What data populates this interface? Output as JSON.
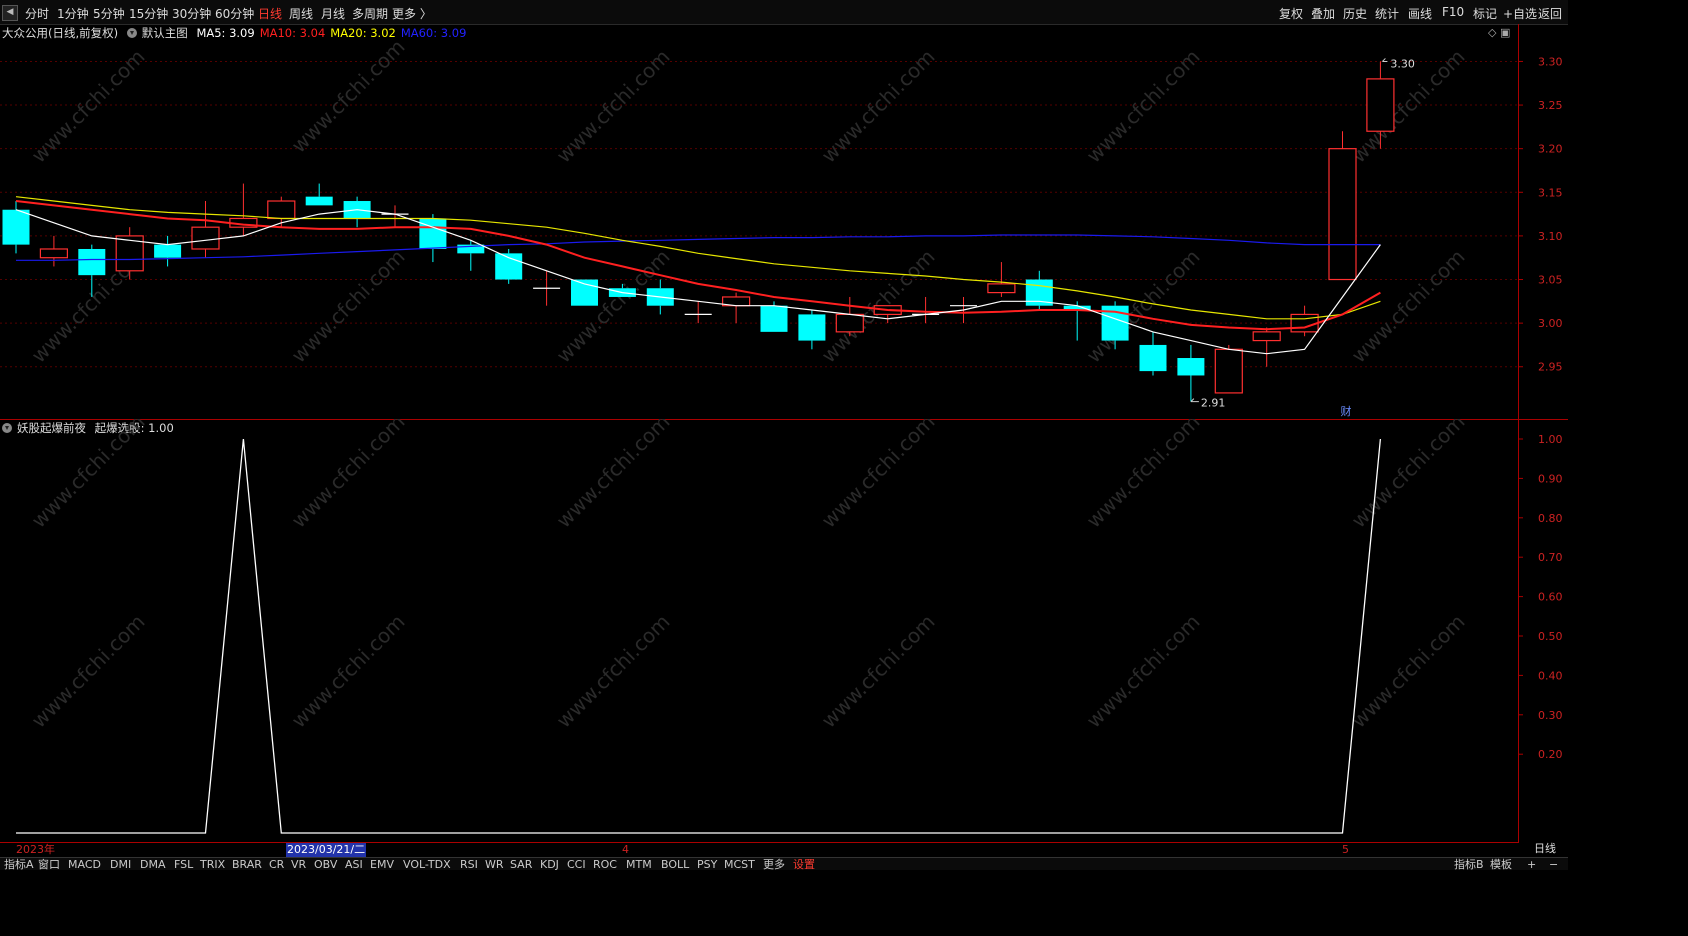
{
  "toolbar": {
    "collapse_icon": "chevron-left-icon",
    "periods": [
      "分时",
      "1分钟",
      "5分钟",
      "15分钟",
      "30分钟",
      "60分钟",
      "日线",
      "周线",
      "月线",
      "多周期",
      "更多 〉"
    ],
    "active_period": "日线",
    "tools": [
      "复权",
      "叠加",
      "历史",
      "统计",
      "画线",
      "F10",
      "标记",
      "+自选",
      "返回"
    ]
  },
  "main_panel": {
    "stock": "大众公用(日线,前复权)",
    "template": "默认主图",
    "ma": [
      {
        "label": "MA5:",
        "value": "3.09",
        "color": "#ffffff"
      },
      {
        "label": "MA10:",
        "value": "3.04",
        "color": "#ff2020"
      },
      {
        "label": "MA20:",
        "value": "3.02",
        "color": "#ffff00"
      },
      {
        "label": "MA60:",
        "value": "3.09",
        "color": "#2222ff"
      }
    ],
    "high_label": "3.30",
    "low_label": "2.91",
    "fin_badge": "财",
    "y_ticks": [
      "3.30",
      "3.25",
      "3.20",
      "3.15",
      "3.10",
      "3.05",
      "3.00",
      "2.95"
    ]
  },
  "indicator_panel": {
    "name": "妖股起爆前夜",
    "output": "起爆选股: 1.00",
    "y_ticks": [
      "1.00",
      "0.90",
      "0.80",
      "0.70",
      "0.60",
      "0.50",
      "0.40",
      "0.30",
      "0.20"
    ]
  },
  "date_axis": {
    "labels": [
      "2023年",
      "2023/03/21/二",
      "4",
      "5"
    ]
  },
  "bottom_tabs": [
    "指标A",
    "窗口",
    "MACD",
    "DMI",
    "DMA",
    "FSL",
    "TRIX",
    "BRAR",
    "CR",
    "VR",
    "OBV",
    "ASI",
    "EMV",
    "VOL-TDX",
    "RSI",
    "WR",
    "SAR",
    "KDJ",
    "CCI",
    "ROC",
    "MTM",
    "BOLL",
    "PSY",
    "MCST",
    "更多",
    "设置"
  ],
  "bottom_right": [
    "指标B",
    "模板",
    "+",
    "−"
  ],
  "right_button": "日线",
  "watermark": "www.cfchi.com",
  "chart_data": [
    {
      "type": "candlestick",
      "title": "大众公用(日线,前复权)",
      "ylim": [
        2.905,
        3.32
      ],
      "up_color": "#ff3030",
      "down_color": "#00ffff",
      "candles": [
        {
          "o": 3.13,
          "h": 3.14,
          "l": 3.08,
          "c": 3.09
        },
        {
          "o": 3.075,
          "h": 3.1,
          "l": 3.065,
          "c": 3.085
        },
        {
          "o": 3.085,
          "h": 3.09,
          "l": 3.03,
          "c": 3.055
        },
        {
          "o": 3.06,
          "h": 3.11,
          "l": 3.05,
          "c": 3.1
        },
        {
          "o": 3.09,
          "h": 3.1,
          "l": 3.065,
          "c": 3.075
        },
        {
          "o": 3.085,
          "h": 3.14,
          "l": 3.075,
          "c": 3.11
        },
        {
          "o": 3.11,
          "h": 3.16,
          "l": 3.1,
          "c": 3.12
        },
        {
          "o": 3.12,
          "h": 3.145,
          "l": 3.11,
          "c": 3.14
        },
        {
          "o": 3.145,
          "h": 3.16,
          "l": 3.135,
          "c": 3.135
        },
        {
          "o": 3.14,
          "h": 3.145,
          "l": 3.11,
          "c": 3.12
        },
        {
          "o": 3.125,
          "h": 3.135,
          "l": 3.11,
          "c": 3.125
        },
        {
          "o": 3.12,
          "h": 3.125,
          "l": 3.07,
          "c": 3.085
        },
        {
          "o": 3.09,
          "h": 3.095,
          "l": 3.06,
          "c": 3.08
        },
        {
          "o": 3.08,
          "h": 3.085,
          "l": 3.045,
          "c": 3.05
        },
        {
          "o": 3.04,
          "h": 3.06,
          "l": 3.02,
          "c": 3.04
        },
        {
          "o": 3.05,
          "h": 3.05,
          "l": 3.02,
          "c": 3.02
        },
        {
          "o": 3.04,
          "h": 3.045,
          "l": 3.03,
          "c": 3.03
        },
        {
          "o": 3.04,
          "h": 3.05,
          "l": 3.01,
          "c": 3.02
        },
        {
          "o": 3.01,
          "h": 3.025,
          "l": 3.0,
          "c": 3.01
        },
        {
          "o": 3.02,
          "h": 3.035,
          "l": 3.0,
          "c": 3.03
        },
        {
          "o": 3.02,
          "h": 3.025,
          "l": 2.99,
          "c": 2.99
        },
        {
          "o": 3.01,
          "h": 3.015,
          "l": 2.97,
          "c": 2.98
        },
        {
          "o": 2.99,
          "h": 3.03,
          "l": 2.985,
          "c": 3.01
        },
        {
          "o": 3.01,
          "h": 3.02,
          "l": 3.0,
          "c": 3.02
        },
        {
          "o": 3.01,
          "h": 3.03,
          "l": 3.0,
          "c": 3.01
        },
        {
          "o": 3.02,
          "h": 3.03,
          "l": 3.0,
          "c": 3.02
        },
        {
          "o": 3.035,
          "h": 3.07,
          "l": 3.03,
          "c": 3.045
        },
        {
          "o": 3.05,
          "h": 3.06,
          "l": 3.015,
          "c": 3.02
        },
        {
          "o": 3.02,
          "h": 3.025,
          "l": 2.98,
          "c": 3.015
        },
        {
          "o": 3.02,
          "h": 3.025,
          "l": 2.97,
          "c": 2.98
        },
        {
          "o": 2.975,
          "h": 2.99,
          "l": 2.94,
          "c": 2.945
        },
        {
          "o": 2.96,
          "h": 2.975,
          "l": 2.91,
          "c": 2.94
        },
        {
          "o": 2.92,
          "h": 2.975,
          "l": 2.92,
          "c": 2.97
        },
        {
          "o": 2.98,
          "h": 2.995,
          "l": 2.95,
          "c": 2.99
        },
        {
          "o": 2.99,
          "h": 3.02,
          "l": 2.985,
          "c": 3.01
        },
        {
          "o": 3.05,
          "h": 3.22,
          "l": 3.05,
          "c": 3.2
        },
        {
          "o": 3.22,
          "h": 3.3,
          "l": 3.2,
          "c": 3.28
        }
      ],
      "ma5": [
        3.13,
        3.115,
        3.1,
        3.095,
        3.09,
        3.095,
        3.1,
        3.115,
        3.125,
        3.13,
        3.125,
        3.11,
        3.095,
        3.075,
        3.06,
        3.045,
        3.035,
        3.03,
        3.025,
        3.02,
        3.02,
        3.015,
        3.01,
        3.005,
        3.01,
        3.015,
        3.025,
        3.025,
        3.02,
        3.005,
        2.99,
        2.98,
        2.97,
        2.965,
        2.97,
        3.03,
        3.09
      ],
      "ma10": [
        3.14,
        3.135,
        3.13,
        3.125,
        3.12,
        3.118,
        3.113,
        3.11,
        3.108,
        3.108,
        3.11,
        3.11,
        3.108,
        3.1,
        3.09,
        3.075,
        3.065,
        3.055,
        3.045,
        3.038,
        3.03,
        3.025,
        3.02,
        3.015,
        3.013,
        3.012,
        3.013,
        3.015,
        3.015,
        3.013,
        3.005,
        2.998,
        2.995,
        2.993,
        2.995,
        3.01,
        3.035
      ],
      "ma20": [
        3.145,
        3.14,
        3.135,
        3.13,
        3.127,
        3.125,
        3.123,
        3.12,
        3.12,
        3.12,
        3.12,
        3.12,
        3.118,
        3.114,
        3.11,
        3.103,
        3.095,
        3.088,
        3.08,
        3.074,
        3.068,
        3.064,
        3.06,
        3.057,
        3.054,
        3.05,
        3.047,
        3.043,
        3.037,
        3.03,
        3.022,
        3.015,
        3.01,
        3.005,
        3.005,
        3.01,
        3.025
      ],
      "ma60": [
        3.072,
        3.072,
        3.073,
        3.073,
        3.074,
        3.075,
        3.076,
        3.078,
        3.08,
        3.082,
        3.084,
        3.086,
        3.088,
        3.09,
        3.091,
        3.093,
        3.094,
        3.095,
        3.096,
        3.097,
        3.098,
        3.098,
        3.099,
        3.099,
        3.1,
        3.1,
        3.101,
        3.101,
        3.101,
        3.1,
        3.099,
        3.097,
        3.095,
        3.092,
        3.09,
        3.09,
        3.09
      ]
    },
    {
      "type": "line",
      "title": "妖股起爆前夜",
      "series": [
        {
          "name": "起爆选股",
          "values": [
            0,
            0,
            0,
            0,
            0,
            0,
            1,
            0,
            0,
            0,
            0,
            0,
            0,
            0,
            0,
            0,
            0,
            0,
            0,
            0,
            0,
            0,
            0,
            0,
            0,
            0,
            0,
            0,
            0,
            0,
            0,
            0,
            0,
            0,
            0,
            0,
            1
          ]
        }
      ],
      "ylim": [
        0,
        1.0
      ]
    }
  ]
}
